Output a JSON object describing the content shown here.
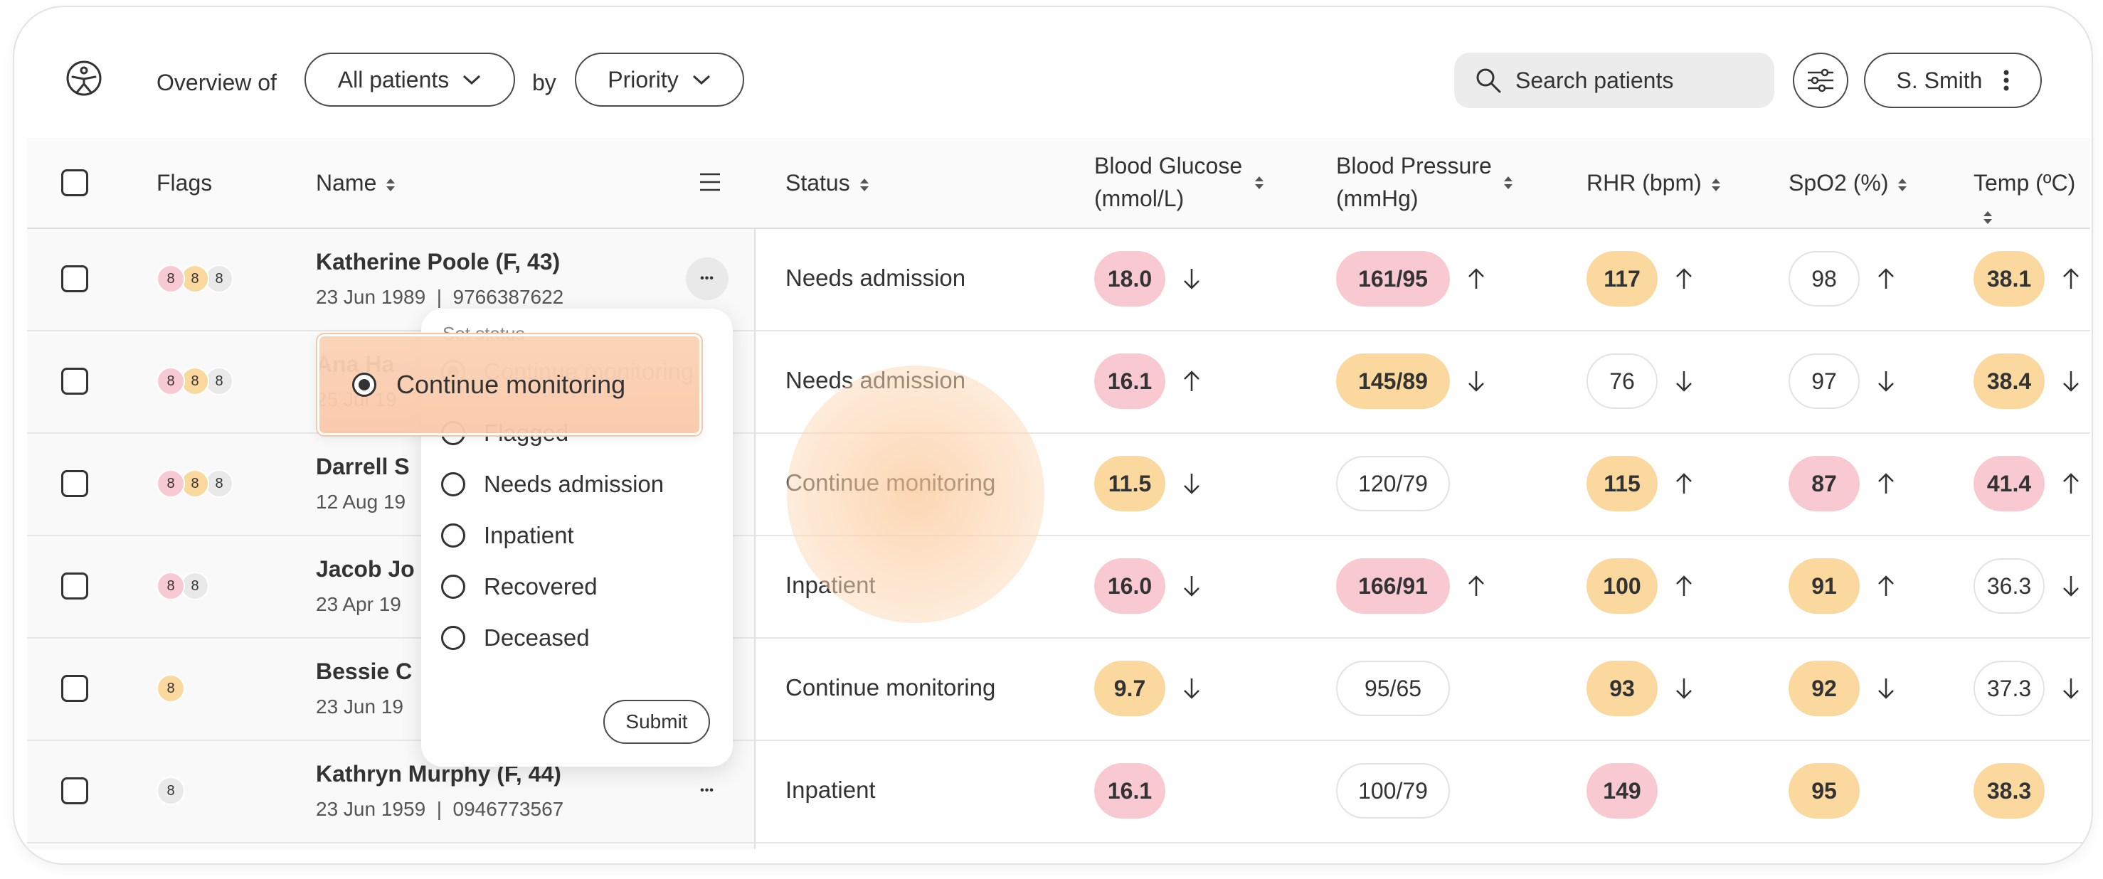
{
  "topbar": {
    "overview_label": "Overview of",
    "patients_filter": "All patients",
    "by_label": "by",
    "sort_filter": "Priority",
    "search_placeholder": "Search patients",
    "user_name": "S. Smith"
  },
  "table": {
    "headers": {
      "flags": "Flags",
      "name": "Name",
      "status": "Status",
      "glucose_1": "Blood Glucose",
      "glucose_2": "(mmol/L)",
      "pressure_1": "Blood Pressure",
      "pressure_2": "(mmHg)",
      "rhr": "RHR (bpm)",
      "spo2": "SpO2 (%)",
      "temp": "Temp (ºC)"
    },
    "rows": [
      {
        "name": "Katherine Poole (F, 43)",
        "meta": "23 Jun 1989  |  9766387622",
        "flags": [
          {
            "v": "8",
            "c": "pink"
          },
          {
            "v": "8",
            "c": "orange"
          },
          {
            "v": "8",
            "c": "grey"
          }
        ],
        "status": "Needs admission",
        "glucose": {
          "v": "18.0",
          "c": "pink",
          "trend": "down"
        },
        "pressure": {
          "v": "161/95",
          "c": "pink",
          "trend": "up"
        },
        "rhr": {
          "v": "117",
          "c": "orange",
          "trend": "up"
        },
        "spo2": {
          "v": "98",
          "c": "white",
          "trend": "up"
        },
        "temp": {
          "v": "38.1",
          "c": "orange",
          "trend": "up"
        }
      },
      {
        "name": "Ana Ha",
        "meta": "25 Jul 19",
        "flags": [
          {
            "v": "8",
            "c": "pink"
          },
          {
            "v": "8",
            "c": "orange"
          },
          {
            "v": "8",
            "c": "grey"
          }
        ],
        "status": "Needs admission",
        "glucose": {
          "v": "16.1",
          "c": "pink",
          "trend": "up"
        },
        "pressure": {
          "v": "145/89",
          "c": "orange",
          "trend": "down"
        },
        "rhr": {
          "v": "76",
          "c": "white",
          "trend": "down"
        },
        "spo2": {
          "v": "97",
          "c": "white",
          "trend": "down"
        },
        "temp": {
          "v": "38.4",
          "c": "orange",
          "trend": "down"
        }
      },
      {
        "name": "Darrell S",
        "meta": "12 Aug 19",
        "flags": [
          {
            "v": "8",
            "c": "pink"
          },
          {
            "v": "8",
            "c": "orange"
          },
          {
            "v": "8",
            "c": "grey"
          }
        ],
        "status": "Continue monitoring",
        "glucose": {
          "v": "11.5",
          "c": "orange",
          "trend": "down"
        },
        "pressure": {
          "v": "120/79",
          "c": "white",
          "trend": "none"
        },
        "rhr": {
          "v": "115",
          "c": "orange",
          "trend": "up"
        },
        "spo2": {
          "v": "87",
          "c": "pink",
          "trend": "up"
        },
        "temp": {
          "v": "41.4",
          "c": "pink",
          "trend": "up"
        }
      },
      {
        "name": "Jacob Jo",
        "meta": "23 Apr 19",
        "flags": [
          {
            "v": "8",
            "c": "pink"
          },
          {
            "v": "8",
            "c": "grey"
          }
        ],
        "status": "Inpatient",
        "glucose": {
          "v": "16.0",
          "c": "pink",
          "trend": "down"
        },
        "pressure": {
          "v": "166/91",
          "c": "pink",
          "trend": "up"
        },
        "rhr": {
          "v": "100",
          "c": "orange",
          "trend": "up"
        },
        "spo2": {
          "v": "91",
          "c": "orange",
          "trend": "up"
        },
        "temp": {
          "v": "36.3",
          "c": "white",
          "trend": "down"
        }
      },
      {
        "name": "Bessie C",
        "meta": "23 Jun 19",
        "flags": [
          {
            "v": "8",
            "c": "orange"
          }
        ],
        "status": "Continue monitoring",
        "glucose": {
          "v": "9.7",
          "c": "orange",
          "trend": "down"
        },
        "pressure": {
          "v": "95/65",
          "c": "white",
          "trend": "none"
        },
        "rhr": {
          "v": "93",
          "c": "orange",
          "trend": "down"
        },
        "spo2": {
          "v": "92",
          "c": "orange",
          "trend": "down"
        },
        "temp": {
          "v": "37.3",
          "c": "white",
          "trend": "down"
        }
      },
      {
        "name": "Kathryn Murphy (F, 44)",
        "meta": "23 Jun 1959  |  0946773567",
        "flags": [
          {
            "v": "8",
            "c": "grey"
          }
        ],
        "status": "Inpatient",
        "glucose": {
          "v": "16.1",
          "c": "pink",
          "trend": "none"
        },
        "pressure": {
          "v": "100/79",
          "c": "white",
          "trend": "none"
        },
        "rhr": {
          "v": "149",
          "c": "pink",
          "trend": "none"
        },
        "spo2": {
          "v": "95",
          "c": "orange",
          "trend": "none"
        },
        "temp": {
          "v": "38.3",
          "c": "orange",
          "trend": "none"
        }
      }
    ]
  },
  "popup": {
    "title": "Set status",
    "options": [
      {
        "label": "Continue monitoring",
        "selected": true
      },
      {
        "label": "Flagged",
        "selected": false
      },
      {
        "label": "Needs admission",
        "selected": false
      },
      {
        "label": "Inpatient",
        "selected": false
      },
      {
        "label": "Recovered",
        "selected": false
      },
      {
        "label": "Deceased",
        "selected": false
      }
    ],
    "submit_label": "Submit",
    "drag_label": "Continue monitoring"
  },
  "colors": {
    "pink": "#f9c9d2",
    "orange": "#fbd99e",
    "grey": "#e9e9e9",
    "white": "#ffffff",
    "border": "#4a4a4a"
  }
}
